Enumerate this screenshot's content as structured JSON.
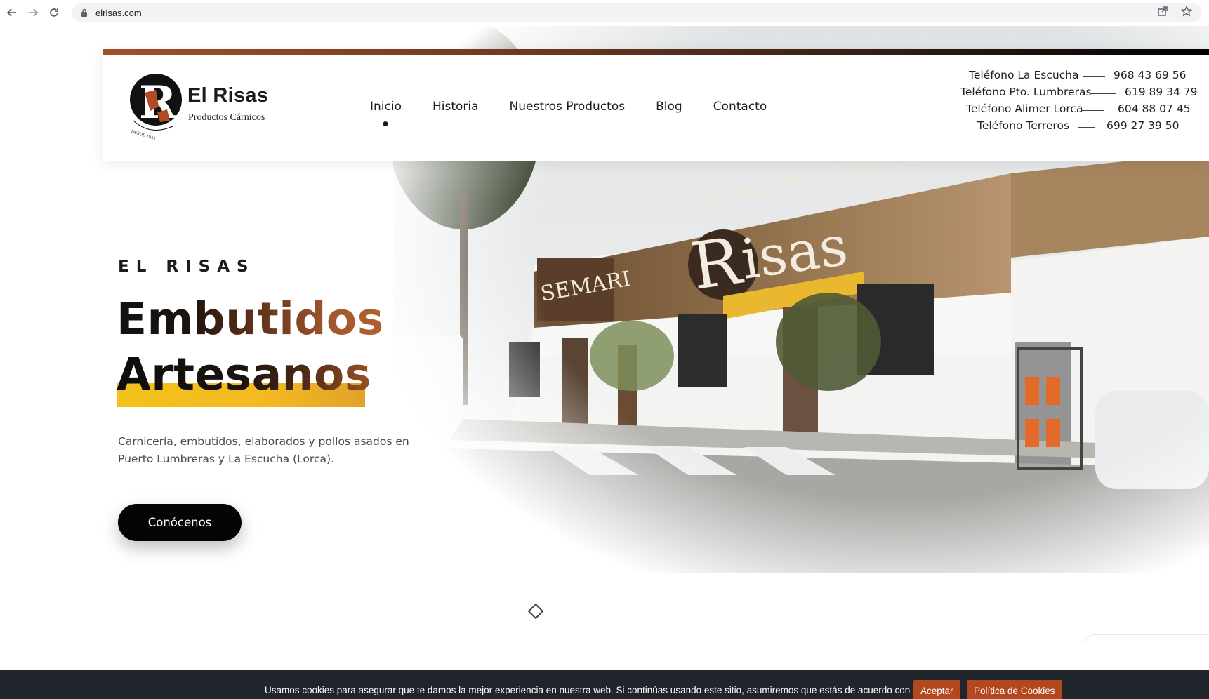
{
  "browser": {
    "url": "elrisas.com",
    "back_icon": "arrow-left-icon",
    "forward_icon": "arrow-right-icon",
    "reload_icon": "reload-icon",
    "share_icon": "share-icon",
    "bookmark_icon": "star-icon"
  },
  "brand": {
    "name": "El Risas",
    "tagline": "Productos Cárnicos",
    "emblem_text": "DESDE 1945"
  },
  "nav": {
    "items": [
      {
        "label": "Inicio",
        "active": true
      },
      {
        "label": "Historia",
        "active": false
      },
      {
        "label": "Nuestros Productos",
        "active": false
      },
      {
        "label": "Blog",
        "active": false
      },
      {
        "label": "Contacto",
        "active": false
      }
    ]
  },
  "phones": [
    {
      "label": "Teléfono La Escucha",
      "number": "968 43 69 56"
    },
    {
      "label": "Teléfono Pto. Lumbreras",
      "number": "619 89 34 79"
    },
    {
      "label": "Teléfono Alimer Lorca",
      "number": "604 88 07 45"
    },
    {
      "label": "Teléfono Terreros",
      "number": "699 27 39 50"
    }
  ],
  "hero": {
    "kicker": "EL RISAS",
    "headline_1": "Embutidos",
    "headline_2": "Artesanos",
    "description": "Carnicería, embutidos, elaborados y pollos asados en Puerto Lumbreras y La Escucha (Lorca).",
    "cta_label": "Conócenos"
  },
  "cookie_banner": {
    "message": "Usamos cookies para asegurar que te damos la mejor experiencia en nuestra web. Si continúas usando este sitio, asumiremos que estás de acuerdo con ello.",
    "accept_label": "Aceptar",
    "policy_label": "Política de Cookies"
  },
  "colors": {
    "accent_brown": "#a0502a",
    "highlight_yellow": "#f2c21b",
    "cookie_button": "#b3471d",
    "cookie_bg": "#20242b"
  }
}
